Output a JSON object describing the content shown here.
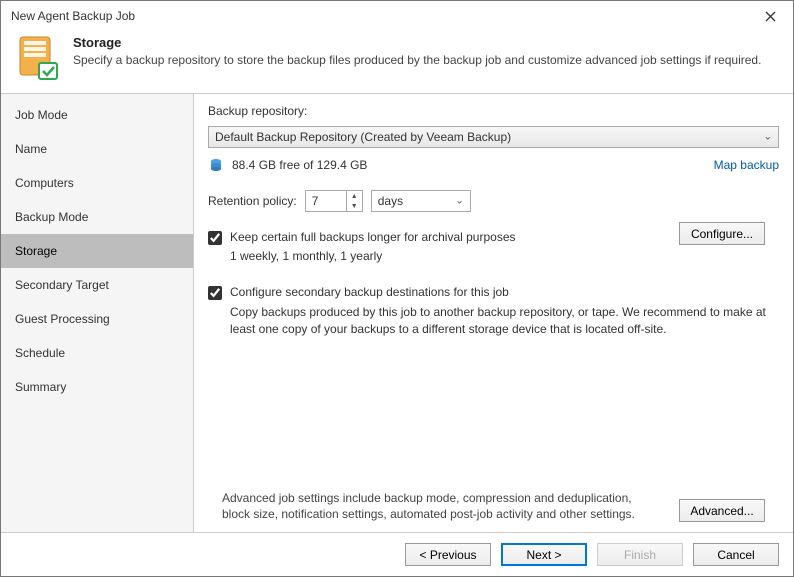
{
  "window": {
    "title": "New Agent Backup Job"
  },
  "banner": {
    "title": "Storage",
    "subtitle": "Specify a backup repository to store the backup files produced by the backup job and customize advanced job settings if required."
  },
  "sidebar": {
    "items": [
      "Job Mode",
      "Name",
      "Computers",
      "Backup Mode",
      "Storage",
      "Secondary Target",
      "Guest Processing",
      "Schedule",
      "Summary"
    ],
    "selected": "Storage"
  },
  "content": {
    "repo_label": "Backup repository:",
    "repo_value": "Default Backup Repository (Created by Veeam Backup)",
    "free_space": "88.4 GB free of 129.4 GB",
    "map_link": "Map backup",
    "retention_label": "Retention policy:",
    "retention_value": "7",
    "retention_units": "days",
    "keep_full_label": "Keep certain full backups longer for archival purposes",
    "keep_full_schedule": "1 weekly, 1 monthly, 1 yearly",
    "configure_btn": "Configure...",
    "secondary_label": "Configure secondary backup destinations for this job",
    "secondary_desc": "Copy backups produced by this job to another backup repository, or tape. We recommend to make at least one copy of your backups to a different storage device that is located off-site.",
    "advanced_text": "Advanced job settings include backup mode, compression and deduplication, block size, notification settings, automated post-job activity and other settings.",
    "advanced_btn": "Advanced..."
  },
  "footer": {
    "previous": "< Previous",
    "next": "Next >",
    "finish": "Finish",
    "cancel": "Cancel"
  }
}
